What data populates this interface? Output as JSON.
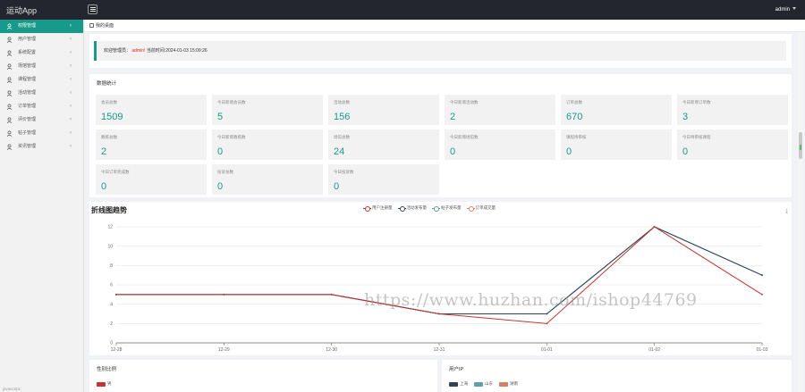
{
  "app": {
    "title": "运动App",
    "user": "admin"
  },
  "sidebar": {
    "items": [
      {
        "label": "权限管理",
        "icon": "user-icon",
        "active": true
      },
      {
        "label": "用户管理",
        "icon": "person-icon",
        "active": false
      },
      {
        "label": "系统配置",
        "icon": "gear-icon",
        "active": false
      },
      {
        "label": "场馆管理",
        "icon": "info-icon",
        "active": false
      },
      {
        "label": "课程管理",
        "icon": "card-icon",
        "active": false
      },
      {
        "label": "活动管理",
        "icon": "flag-icon",
        "active": false
      },
      {
        "label": "订单管理",
        "icon": "cart-icon",
        "active": false
      },
      {
        "label": "评价管理",
        "icon": "comment-icon",
        "active": false
      },
      {
        "label": "帖子管理",
        "icon": "post-icon",
        "active": false
      },
      {
        "label": "资讯管理",
        "icon": "news-icon",
        "active": false
      }
    ],
    "footer": "javascript:;"
  },
  "tabs": [
    {
      "label": "我的桌面"
    }
  ],
  "welcome": {
    "prefix": "欢迎管理员：",
    "name": "admin!",
    "time_label": "当前时间:2024-01-03 15:09:26"
  },
  "stats": {
    "title": "数据统计",
    "items": [
      {
        "label": "会员总数",
        "value": "1509"
      },
      {
        "label": "今日新增会员数",
        "value": "5"
      },
      {
        "label": "活动总数",
        "value": "156"
      },
      {
        "label": "今日新增活动数",
        "value": "2"
      },
      {
        "label": "订单总数",
        "value": "670"
      },
      {
        "label": "今日新增订单数",
        "value": "3"
      },
      {
        "label": "教练总数",
        "value": "2"
      },
      {
        "label": "今日新增教练数",
        "value": "0"
      },
      {
        "label": "场馆总数",
        "value": "24"
      },
      {
        "label": "今日新增场馆数",
        "value": "0"
      },
      {
        "label": "课程待审核",
        "value": "0"
      },
      {
        "label": "今日待审核课程",
        "value": "0"
      },
      {
        "label": "今日订单完成数",
        "value": "0"
      },
      {
        "label": "投诉总数",
        "value": "0"
      },
      {
        "label": "今日投诉数",
        "value": "0"
      }
    ]
  },
  "chart_data": {
    "type": "line",
    "title": "折线图趋势",
    "categories": [
      "12-28",
      "12-29",
      "12-30",
      "12-31",
      "01-01",
      "01-02",
      "01-03"
    ],
    "ylim": [
      0,
      12
    ],
    "yticks": [
      0,
      2,
      4,
      6,
      8,
      10,
      12
    ],
    "grid": true,
    "legend_position": "top-center",
    "series": [
      {
        "name": "用户注册量",
        "color": "#c23531",
        "values": [
          5,
          5,
          5,
          3,
          2,
          12,
          5
        ]
      },
      {
        "name": "活动发布量",
        "color": "#2f4554",
        "values": [
          5,
          5,
          5,
          3,
          3,
          12,
          7
        ]
      },
      {
        "name": "帖子发布量",
        "color": "#61a0a8",
        "values": [
          5,
          5,
          5,
          3,
          3,
          12,
          7
        ]
      },
      {
        "name": "订单成交量",
        "color": "#d48265",
        "values": [
          5,
          5,
          5,
          3,
          3,
          12,
          7
        ]
      }
    ]
  },
  "watermark": "https://www.huzhan.com/ishop44769",
  "pie_left": {
    "title": "性别比例",
    "legend": [
      {
        "label": "男",
        "color": "#c23531"
      }
    ]
  },
  "pie_right": {
    "title": "用户IP",
    "legend": [
      {
        "label": "上海",
        "color": "#2f4554"
      },
      {
        "label": "山东",
        "color": "#61a0a8"
      },
      {
        "label": "湖南",
        "color": "#d48265"
      }
    ]
  }
}
